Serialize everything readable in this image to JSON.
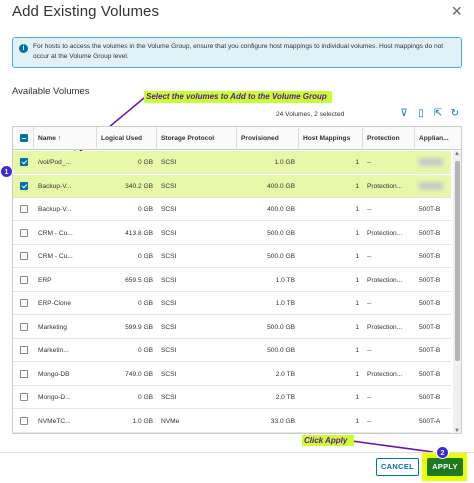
{
  "dialog": {
    "title": "Add Existing Volumes",
    "close_glyph": "×",
    "info_icon": "i",
    "info_text": "For hosts to access the volumes in the Volume Group, ensure that you configure host mappings to individual volumes. Host mappings do not occur at the Volume Group level.",
    "section_title": "Available Volumes",
    "count_text": "24 Volumes, 2 selected"
  },
  "annotations": {
    "callout_select": "Select the volumes to Add to the Volume Group",
    "callout_apply": "Click Apply",
    "badge_1": "1",
    "badge_2": "2",
    "color": "#6a0dad",
    "highlight": "#c8ff2e"
  },
  "toolbar": {
    "icons": [
      "filter-icon",
      "columns-icon",
      "export-icon",
      "refresh-icon"
    ],
    "glyphs": [
      "⊽",
      "▯",
      "⇱",
      "↻"
    ]
  },
  "grid": {
    "columns": [
      "Name",
      "Logical Used",
      "Storage Protocol",
      "Provisioned",
      "Host Mappings",
      "Protection",
      "Applian..."
    ],
    "sort_glyph": "↑",
    "rows": [
      {
        "selected": true,
        "name": "/vol/Pod_...",
        "logical_used": "0 GB",
        "protocol": "SCSI",
        "provisioned": "1.0 GB",
        "host_mappings": "1",
        "protection": "--",
        "appliance": ""
      },
      {
        "selected": true,
        "name": "Backup-V...",
        "logical_used": "340.2 GB",
        "protocol": "SCSI",
        "provisioned": "400.0 GB",
        "host_mappings": "1",
        "protection": "Protection...",
        "appliance": ""
      },
      {
        "selected": false,
        "name": "Backup-V...",
        "logical_used": "0 GB",
        "protocol": "SCSI",
        "provisioned": "400.0 GB",
        "host_mappings": "1",
        "protection": "--",
        "appliance": "500T-B"
      },
      {
        "selected": false,
        "name": "CRM - Cu...",
        "logical_used": "413.8 GB",
        "protocol": "SCSI",
        "provisioned": "500.0 GB",
        "host_mappings": "1",
        "protection": "Protection...",
        "appliance": "500T-B"
      },
      {
        "selected": false,
        "name": "CRM - Cu...",
        "logical_used": "0 GB",
        "protocol": "SCSI",
        "provisioned": "500.0 GB",
        "host_mappings": "1",
        "protection": "--",
        "appliance": "500T-B"
      },
      {
        "selected": false,
        "name": "ERP",
        "logical_used": "659.5 GB",
        "protocol": "SCSI",
        "provisioned": "1.0 TB",
        "host_mappings": "1",
        "protection": "Protection...",
        "appliance": "500T-B"
      },
      {
        "selected": false,
        "name": "ERP-Clone",
        "logical_used": "0 GB",
        "protocol": "SCSI",
        "provisioned": "1.0 TB",
        "host_mappings": "1",
        "protection": "--",
        "appliance": "500T-B"
      },
      {
        "selected": false,
        "name": "Marketing",
        "logical_used": "599.9 GB",
        "protocol": "SCSI",
        "provisioned": "500.0 GB",
        "host_mappings": "1",
        "protection": "Protection...",
        "appliance": "500T-B"
      },
      {
        "selected": false,
        "name": "Marketin...",
        "logical_used": "0 GB",
        "protocol": "SCSI",
        "provisioned": "500.0 GB",
        "host_mappings": "1",
        "protection": "--",
        "appliance": "500T-B"
      },
      {
        "selected": false,
        "name": "Mongo-DB",
        "logical_used": "749.0 GB",
        "protocol": "SCSI",
        "provisioned": "2.0 TB",
        "host_mappings": "1",
        "protection": "Protection...",
        "appliance": "500T-B"
      },
      {
        "selected": false,
        "name": "Mongo-D...",
        "logical_used": "0 GB",
        "protocol": "SCSI",
        "provisioned": "2.0 TB",
        "host_mappings": "1",
        "protection": "--",
        "appliance": "500T-B"
      },
      {
        "selected": false,
        "name": "NVMeTC...",
        "logical_used": "1.0 GB",
        "protocol": "NVMe",
        "provisioned": "33.0 GB",
        "host_mappings": "1",
        "protection": "--",
        "appliance": "500T-A"
      }
    ]
  },
  "footer": {
    "cancel_label": "CANCEL",
    "apply_label": "APPLY"
  },
  "colors": {
    "accent": "#0072a3",
    "apply": "#1f7a1f",
    "selected_row": "#e7f9a8"
  }
}
